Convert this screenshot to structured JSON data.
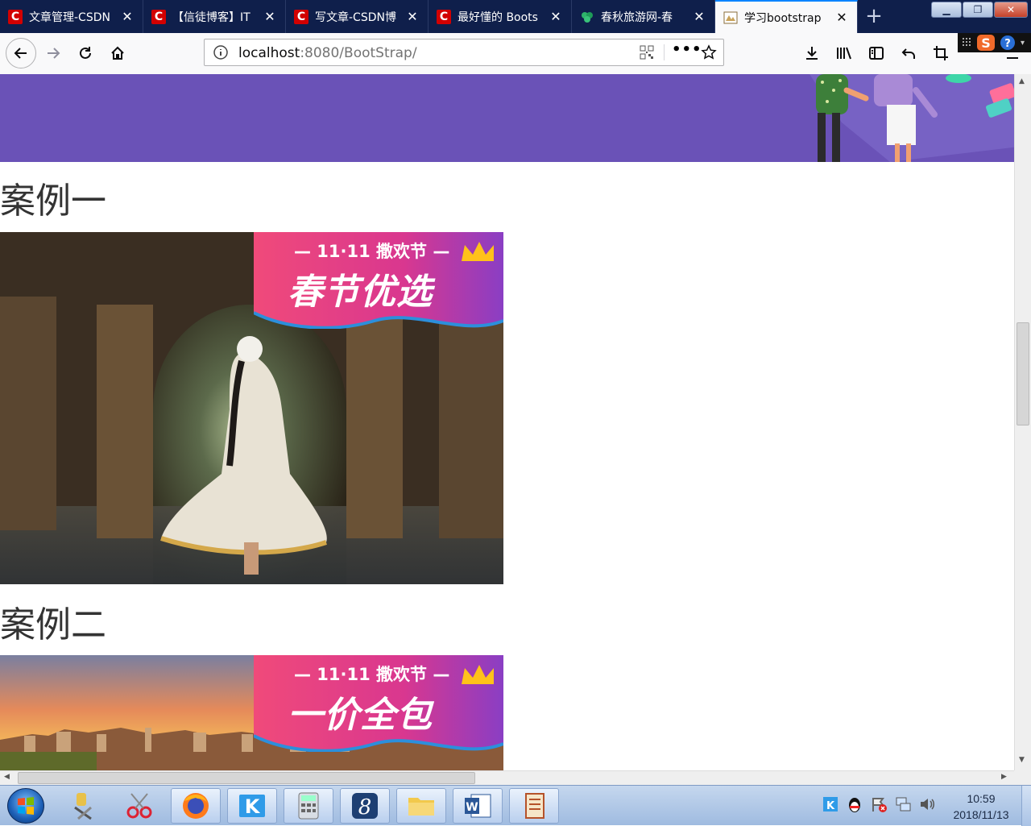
{
  "browser": {
    "tabs": [
      {
        "title": "文章管理-CSDN",
        "icon": "csdn"
      },
      {
        "title": "【信徒博客】IT",
        "icon": "csdn"
      },
      {
        "title": "写文章-CSDN博",
        "icon": "csdn"
      },
      {
        "title": "最好懂的 Boots",
        "icon": "csdn"
      },
      {
        "title": "春秋旅游网-春",
        "icon": "springautumn"
      },
      {
        "title": "学习bootstrap",
        "icon": "page",
        "active": true
      }
    ],
    "url_host": "localhost",
    "url_rest": ":8080/BootStrap/",
    "accent": "#0a84ff"
  },
  "page": {
    "banner_color": "#6a52b7",
    "cases": [
      {
        "heading": "案例一",
        "badge_top": "— 11·11 撒欢节 —",
        "badge_big": "春节优选"
      },
      {
        "heading": "案例二",
        "badge_top": "— 11·11 撒欢节 —",
        "badge_big": "一价全包"
      }
    ]
  },
  "taskbar": {
    "time": "10:59",
    "date": "2018/11/13"
  }
}
